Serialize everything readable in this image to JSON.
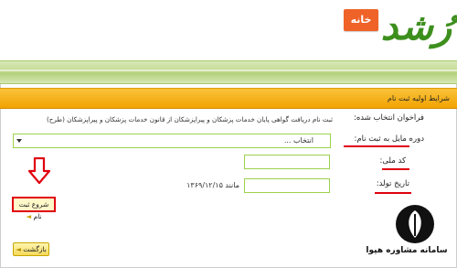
{
  "header": {
    "logo_text": "رُشد",
    "home_label": "خانه"
  },
  "section": {
    "title": "شرایط اولیه ثبت نام"
  },
  "form": {
    "call_label": "فراخوان انتخاب شده:",
    "call_value": "ثبت نام دریافت گواهی پایان خدمات پزشکان و پیراپزشکان از قانون خدمات پزشکان و پیراپزشکان (طرح)",
    "period_label": "دوره مایل به ثبت نام:",
    "period_selected": "انتخاب ...",
    "code_label": "کد ملی:",
    "birth_label": "تاریخ تولد:",
    "birth_example": "مانند ۱۳۶۹/۱۲/۱۵",
    "start_label": "شروع ثبت نام",
    "back_label": "بازگشت"
  },
  "watermark": {
    "text": "سامانه مشاوره هپوا"
  },
  "colors": {
    "accent_orange": "#f2a300",
    "home_button": "#ef6228",
    "highlight_red": "#e0000f",
    "input_border": "#9bd24b"
  },
  "icons": {
    "arrow": "down-arrow-icon",
    "button_arrow": "arrow-left-icon"
  }
}
